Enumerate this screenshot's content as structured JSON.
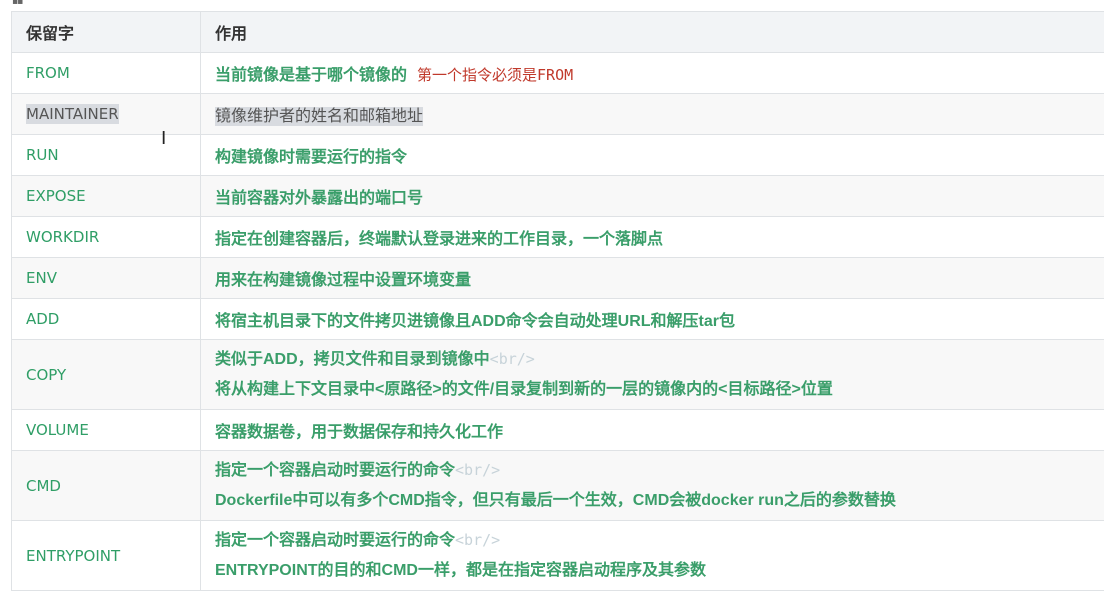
{
  "header": {
    "col_keyword": "保留字",
    "col_usage": "作用"
  },
  "rows": [
    {
      "keyword": "FROM",
      "lines": [
        "当前镜像是基于哪个镜像的"
      ],
      "note": "第一个指令必须是FROM"
    },
    {
      "keyword": "MAINTAINER",
      "lines": [
        "镜像维护者的姓名和邮箱地址"
      ],
      "selected": true
    },
    {
      "keyword": "RUN",
      "lines": [
        "构建镜像时需要运行的指令"
      ]
    },
    {
      "keyword": "EXPOSE",
      "lines": [
        "当前容器对外暴露出的端口号"
      ]
    },
    {
      "keyword": "WORKDIR",
      "lines": [
        "指定在创建容器后，终端默认登录进来的工作目录，一个落脚点"
      ]
    },
    {
      "keyword": "ENV",
      "lines": [
        "用来在构建镜像过程中设置环境变量"
      ]
    },
    {
      "keyword": "ADD",
      "lines": [
        "将宿主机目录下的文件拷贝进镜像且ADD命令会自动处理URL和解压tar包"
      ]
    },
    {
      "keyword": "COPY",
      "lines": [
        "类似于ADD，拷贝文件和目录到镜像中",
        "将从构建上下文目录中<原路径>的文件/目录复制到新的一层的镜像内的<目标路径>位置"
      ],
      "tag": "<br/>"
    },
    {
      "keyword": "VOLUME",
      "lines": [
        "容器数据卷，用于数据保存和持久化工作"
      ]
    },
    {
      "keyword": "CMD",
      "lines": [
        "指定一个容器启动时要运行的命令",
        "Dockerfile中可以有多个CMD指令，但只有最后一个生效，CMD会被docker run之后的参数替换"
      ],
      "tag": "<br/>"
    },
    {
      "keyword": "ENTRYPOINT",
      "lines": [
        "指定一个容器启动时要运行的命令",
        "ENTRYPOINT的目的和CMD一样，都是在指定容器启动程序及其参数"
      ],
      "tag": "<br/>"
    }
  ],
  "colors": {
    "keyword": "#2f9e66",
    "description": "#3a9e6a",
    "note": "#c0392b",
    "tag": "#c7d3d9",
    "border": "#dfe2e5",
    "header_bg": "#f2f4f6"
  },
  "icons": {
    "top_left": "grid-icon",
    "cursor": "text-cursor-icon"
  }
}
